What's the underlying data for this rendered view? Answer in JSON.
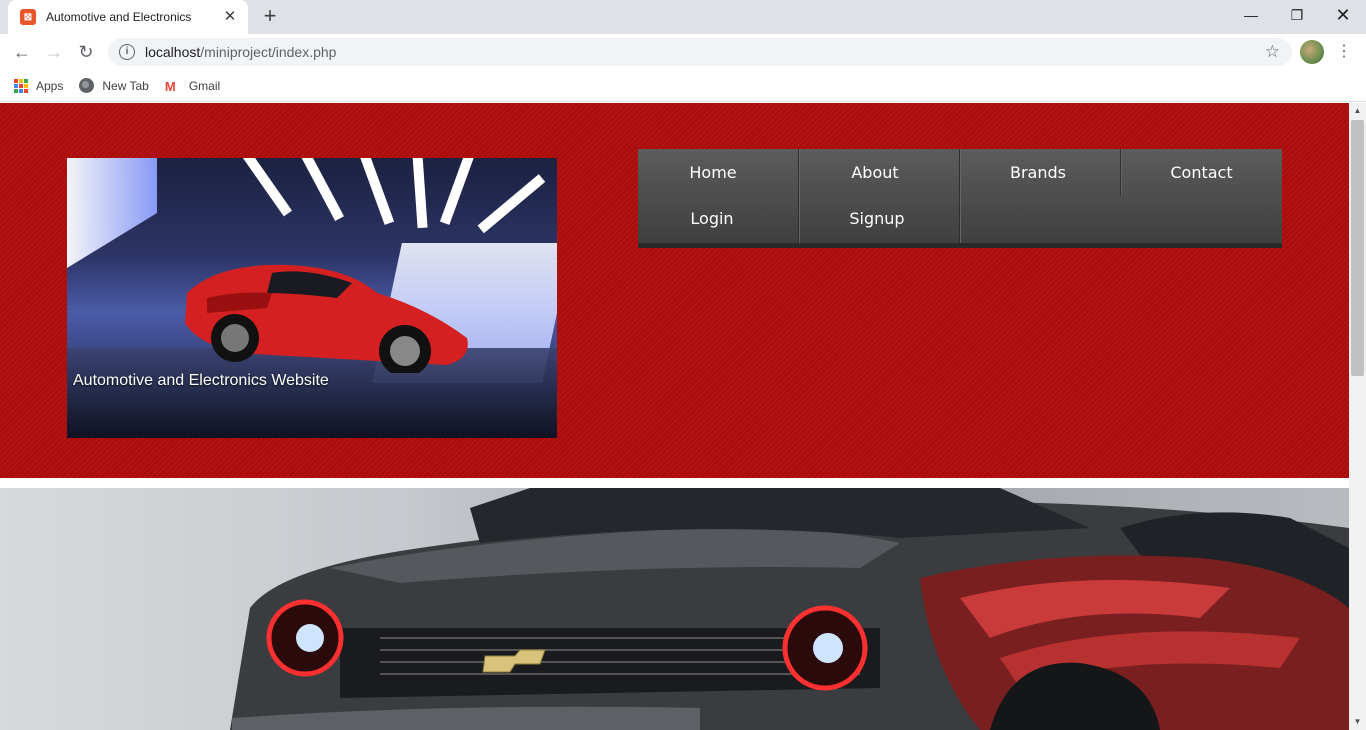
{
  "browser": {
    "tab_title": "Automotive and Electronics",
    "url_host": "localhost",
    "url_path": "/miniproject/index.php",
    "bookmarks": [
      {
        "label": "Apps",
        "icon": "apps-icon"
      },
      {
        "label": "New Tab",
        "icon": "globe-icon"
      },
      {
        "label": "Gmail",
        "icon": "gmail-icon"
      }
    ]
  },
  "site": {
    "banner_caption": "Automotive and Electronics Website",
    "nav": {
      "home": "Home",
      "about": "About",
      "brands": "Brands",
      "contact": "Contact",
      "login": "Login",
      "signup": "Signup"
    },
    "colors": {
      "header_red": "#b10d0d",
      "nav_dark": "#3f3f3f"
    }
  }
}
